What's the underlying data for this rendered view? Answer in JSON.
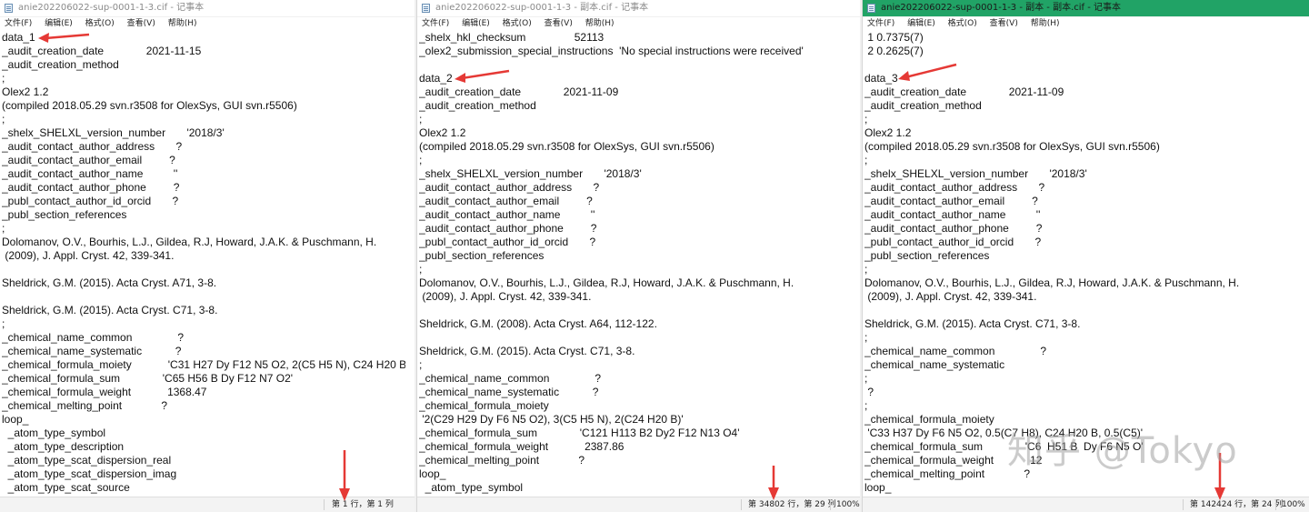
{
  "watermark": "知乎 @Tokyo",
  "colors": {
    "active_title": "#21a366",
    "arrow": "#e53935"
  },
  "windows": [
    {
      "title": "anie202206022-sup-0001-1-3.cif - 记事本",
      "menu": [
        "文件(F)",
        "编辑(E)",
        "格式(O)",
        "查看(V)",
        "帮助(H)"
      ],
      "lines": [
        "data_1",
        "_audit_creation_date              2021-11-15",
        "_audit_creation_method",
        ";",
        "Olex2 1.2",
        "(compiled 2018.05.29 svn.r3508 for OlexSys, GUI svn.r5506)",
        ";",
        "_shelx_SHELXL_version_number       '2018/3'",
        "_audit_contact_author_address       ?",
        "_audit_contact_author_email         ?",
        "_audit_contact_author_name          ''",
        "_audit_contact_author_phone         ?",
        "_publ_contact_author_id_orcid       ?",
        "_publ_section_references",
        ";",
        "Dolomanov, O.V., Bourhis, L.J., Gildea, R.J, Howard, J.A.K. & Puschmann, H.",
        " (2009), J. Appl. Cryst. 42, 339-341.",
        "",
        "Sheldrick, G.M. (2015). Acta Cryst. A71, 3-8.",
        "",
        "Sheldrick, G.M. (2015). Acta Cryst. C71, 3-8.",
        ";",
        "_chemical_name_common               ?",
        "_chemical_name_systematic           ?",
        "_chemical_formula_moiety            'C31 H27 Dy F12 N5 O2, 2(C5 H5 N), C24 H20 B'",
        "_chemical_formula_sum              'C65 H56 B Dy F12 N7 O2'",
        "_chemical_formula_weight            1368.47",
        "_chemical_melting_point             ?",
        "loop_",
        "  _atom_type_symbol",
        "  _atom_type_description",
        "  _atom_type_scat_dispersion_real",
        "  _atom_type_scat_dispersion_imag",
        "  _atom_type_scat_source"
      ],
      "status_position": "第 1 行，第 1 列",
      "zoom": ""
    },
    {
      "title": "anie202206022-sup-0001-1-3 - 副本.cif - 记事本",
      "menu": [
        "文件(F)",
        "编辑(E)",
        "格式(O)",
        "查看(V)",
        "帮助(H)"
      ],
      "lines": [
        "_shelx_hkl_checksum                52113",
        "_olex2_submission_special_instructions  'No special instructions were received'",
        "",
        "data_2",
        "_audit_creation_date              2021-11-09",
        "_audit_creation_method",
        ";",
        "Olex2 1.2",
        "(compiled 2018.05.29 svn.r3508 for OlexSys, GUI svn.r5506)",
        ";",
        "_shelx_SHELXL_version_number       '2018/3'",
        "_audit_contact_author_address       ?",
        "_audit_contact_author_email         ?",
        "_audit_contact_author_name          ''",
        "_audit_contact_author_phone         ?",
        "_publ_contact_author_id_orcid       ?",
        "_publ_section_references",
        ";",
        "Dolomanov, O.V., Bourhis, L.J., Gildea, R.J, Howard, J.A.K. & Puschmann, H.",
        " (2009), J. Appl. Cryst. 42, 339-341.",
        "",
        "Sheldrick, G.M. (2008). Acta Cryst. A64, 112-122.",
        "",
        "Sheldrick, G.M. (2015). Acta Cryst. C71, 3-8.",
        ";",
        "_chemical_name_common               ?",
        "_chemical_name_systematic           ?",
        "_chemical_formula_moiety",
        " '2(C29 H29 Dy F6 N5 O2), 3(C5 H5 N), 2(C24 H20 B)'",
        "_chemical_formula_sum              'C121 H113 B2 Dy2 F12 N13 O4'",
        "_chemical_formula_weight            2387.86",
        "_chemical_melting_point             ?",
        "loop_",
        "  _atom_type_symbol"
      ],
      "status_position": "第 34802 行，第 29 列",
      "zoom": "100%"
    },
    {
      "title": "anie202206022-sup-0001-1-3 - 副本 - 副本.cif - 记事本",
      "menu": [
        "文件(F)",
        "编辑(E)",
        "格式(O)",
        "查看(V)",
        "帮助(H)"
      ],
      "lines": [
        " 1 0.7375(7)",
        " 2 0.2625(7)",
        "",
        "data_3",
        "_audit_creation_date              2021-11-09",
        "_audit_creation_method",
        ";",
        "Olex2 1.2",
        "(compiled 2018.05.29 svn.r3508 for OlexSys, GUI svn.r5506)",
        ";",
        "_shelx_SHELXL_version_number       '2018/3'",
        "_audit_contact_author_address       ?",
        "_audit_contact_author_email         ?",
        "_audit_contact_author_name          ''",
        "_audit_contact_author_phone         ?",
        "_publ_contact_author_id_orcid       ?",
        "_publ_section_references",
        ";",
        "Dolomanov, O.V., Bourhis, L.J., Gildea, R.J, Howard, J.A.K. & Puschmann, H.",
        " (2009), J. Appl. Cryst. 42, 339-341.",
        "",
        "Sheldrick, G.M. (2015). Acta Cryst. C71, 3-8.",
        ";",
        "_chemical_name_common               ?",
        "_chemical_name_systematic",
        ";",
        " ?",
        ";",
        "_chemical_formula_moiety",
        " 'C33 H37 Dy F6 N5 O2, 0.5(C7 H8), C24 H20 B, 0.5(C5)'",
        "_chemical_formula_sum              'C6  H51 B  Dy F6 N5 O'",
        "_chemical_formula_weight            12",
        "_chemical_melting_point             ?",
        "loop_"
      ],
      "status_position": "第 142424 行，第 24 列",
      "zoom": "100%"
    }
  ]
}
